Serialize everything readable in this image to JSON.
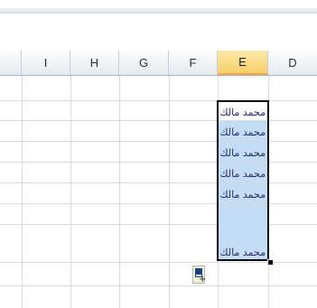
{
  "columns": [
    {
      "label": ""
    },
    {
      "label": "I"
    },
    {
      "label": "H"
    },
    {
      "label": "G"
    },
    {
      "label": "F"
    },
    {
      "label": "E"
    },
    {
      "label": "D"
    }
  ],
  "selected_column": "E",
  "cells": [
    {
      "value": "محمد مالك"
    },
    {
      "value": "محمد مالك"
    },
    {
      "value": "محمد مالك"
    },
    {
      "value": "محمد مالك"
    },
    {
      "value": "محمد مالك"
    },
    {
      "value": "محمد مالك"
    }
  ],
  "colors": {
    "selection_fill": "#c5dcf6",
    "selected_header": "#f8cf6b",
    "gridline": "#dadcdd"
  },
  "icons": {
    "autofill": "auto-fill-options-icon"
  }
}
